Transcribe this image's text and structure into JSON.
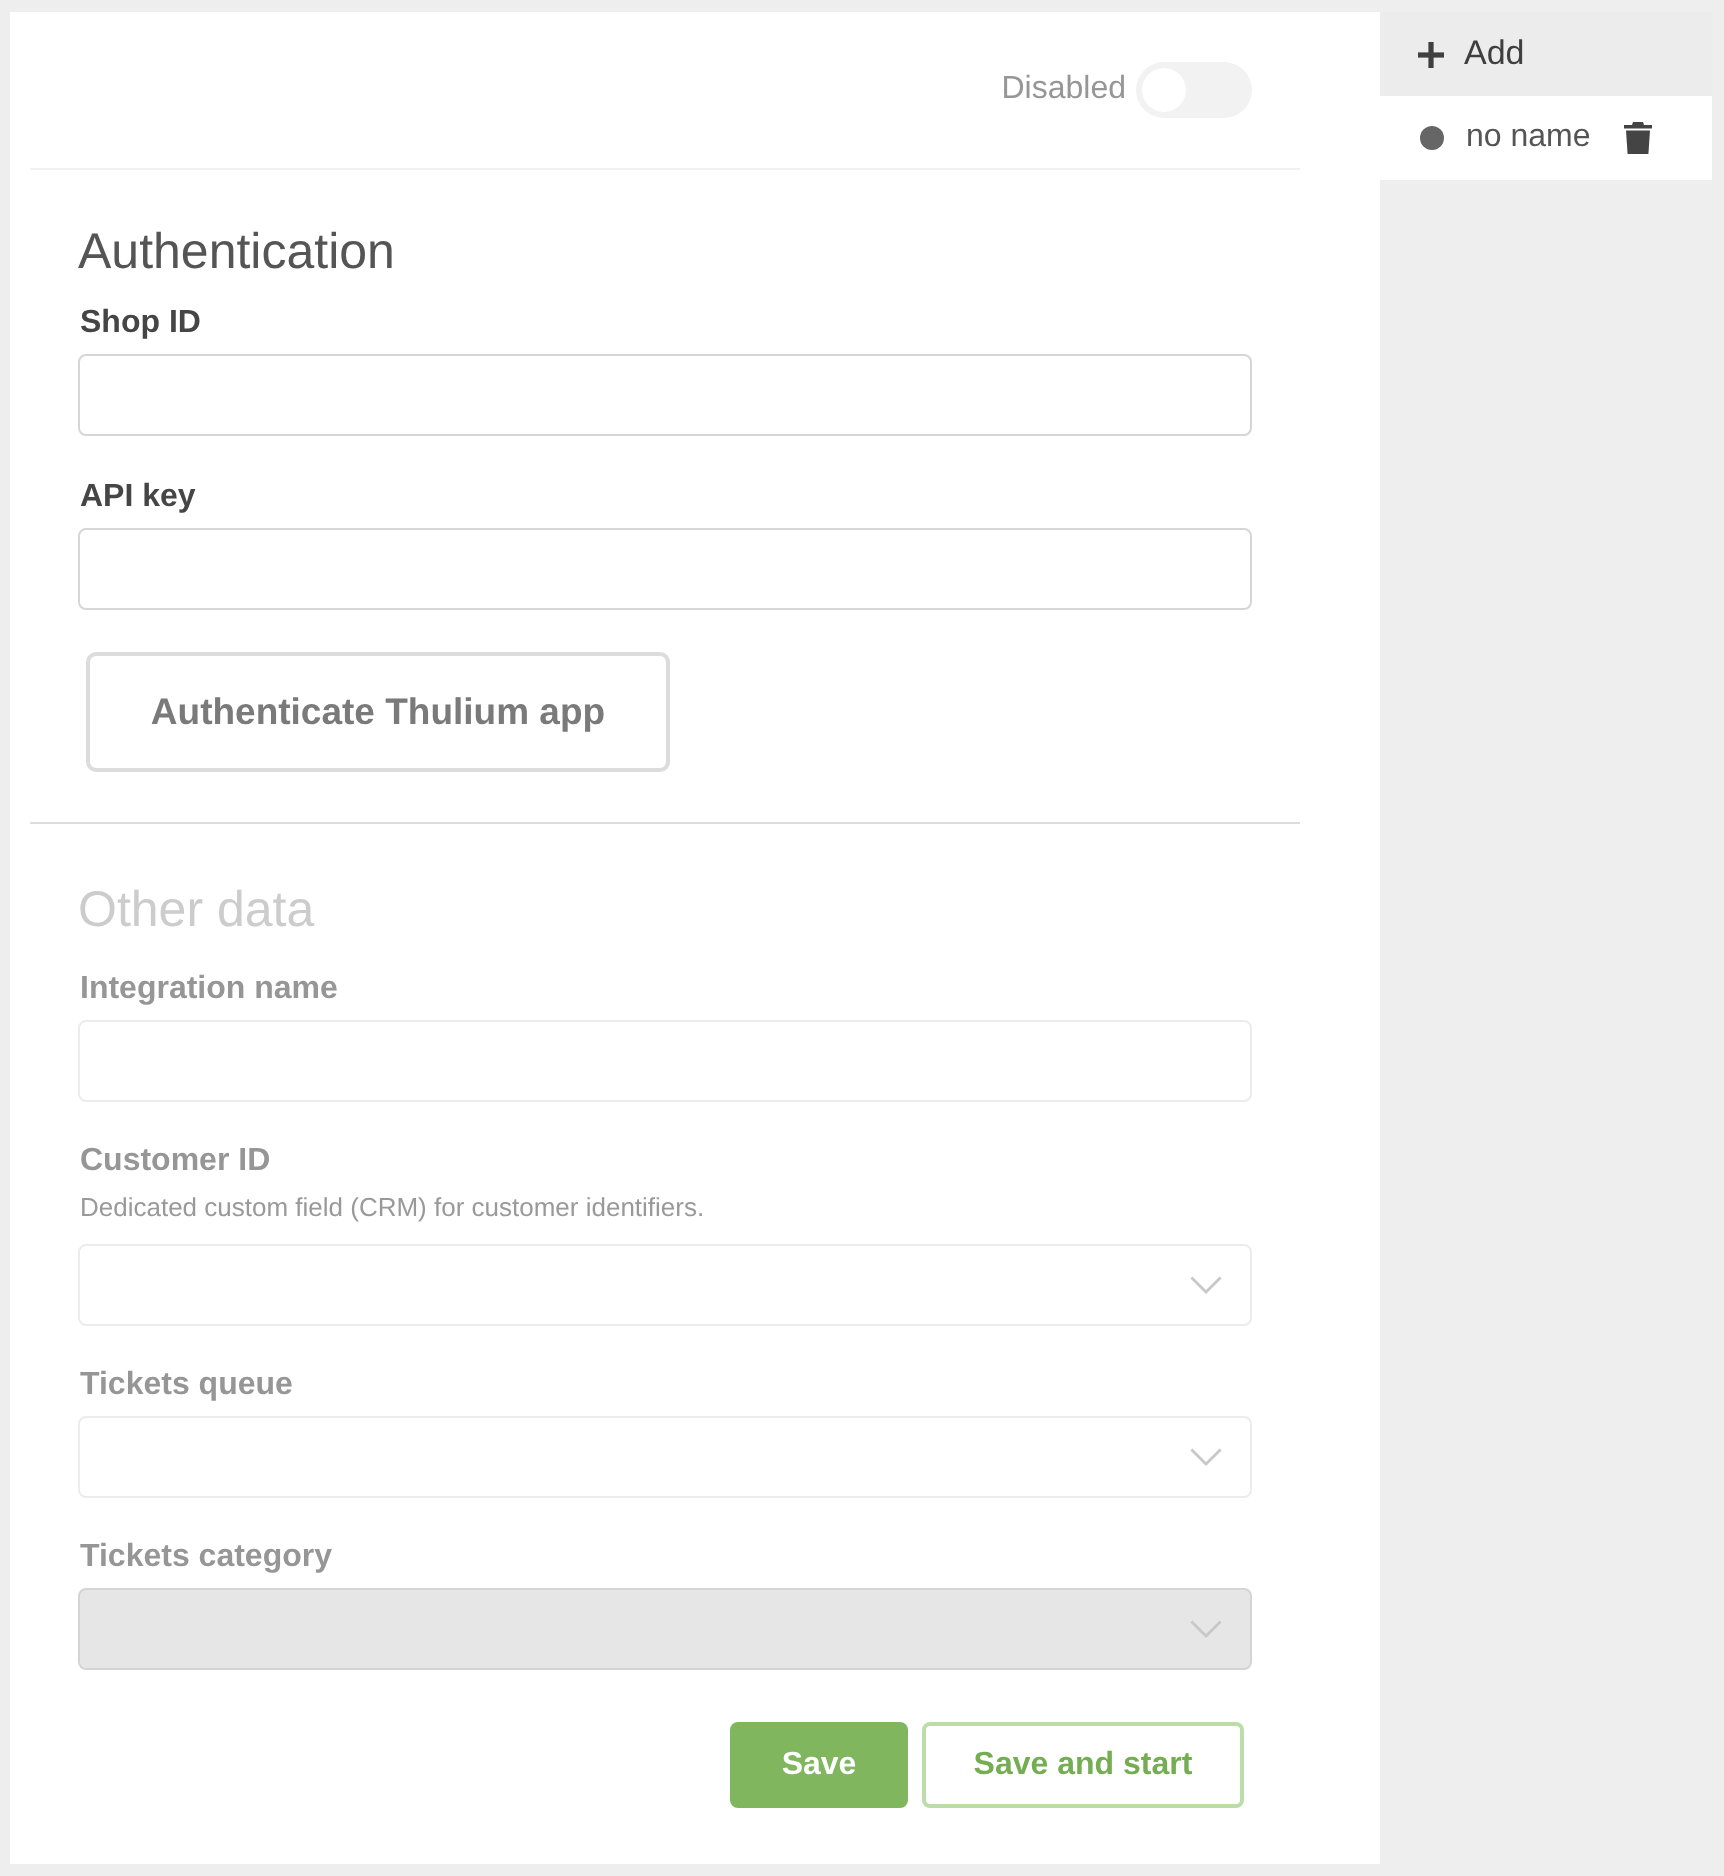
{
  "header": {
    "status_toggle": {
      "label": "Disabled",
      "on": false
    }
  },
  "sections": [
    {
      "title": "Authentication",
      "disabled": false,
      "fields": [
        {
          "kind": "text",
          "label": "Shop ID",
          "disabled": false
        },
        {
          "kind": "text",
          "label": "API key",
          "disabled": false
        }
      ],
      "button": {
        "label": "Authenticate Thulium app"
      }
    },
    {
      "title": "Other data",
      "disabled": true,
      "fields": [
        {
          "kind": "text",
          "label": "Integration name",
          "disabled": false
        },
        {
          "kind": "select",
          "label": "Customer ID",
          "hint": "Dedicated custom field (CRM) for customer identifiers.",
          "disabled": false
        },
        {
          "kind": "select",
          "label": "Tickets queue",
          "disabled": false
        },
        {
          "kind": "select",
          "label": "Tickets category",
          "disabled": true
        }
      ]
    }
  ],
  "actions": [
    {
      "kind": "primary",
      "label": "Save",
      "disabled": true
    },
    {
      "kind": "secondary",
      "label": "Save and start",
      "disabled": true
    }
  ],
  "sidebar": {
    "add_button": {
      "label": "Add"
    },
    "items": [
      {
        "label": "no name",
        "selected": true
      }
    ]
  }
}
